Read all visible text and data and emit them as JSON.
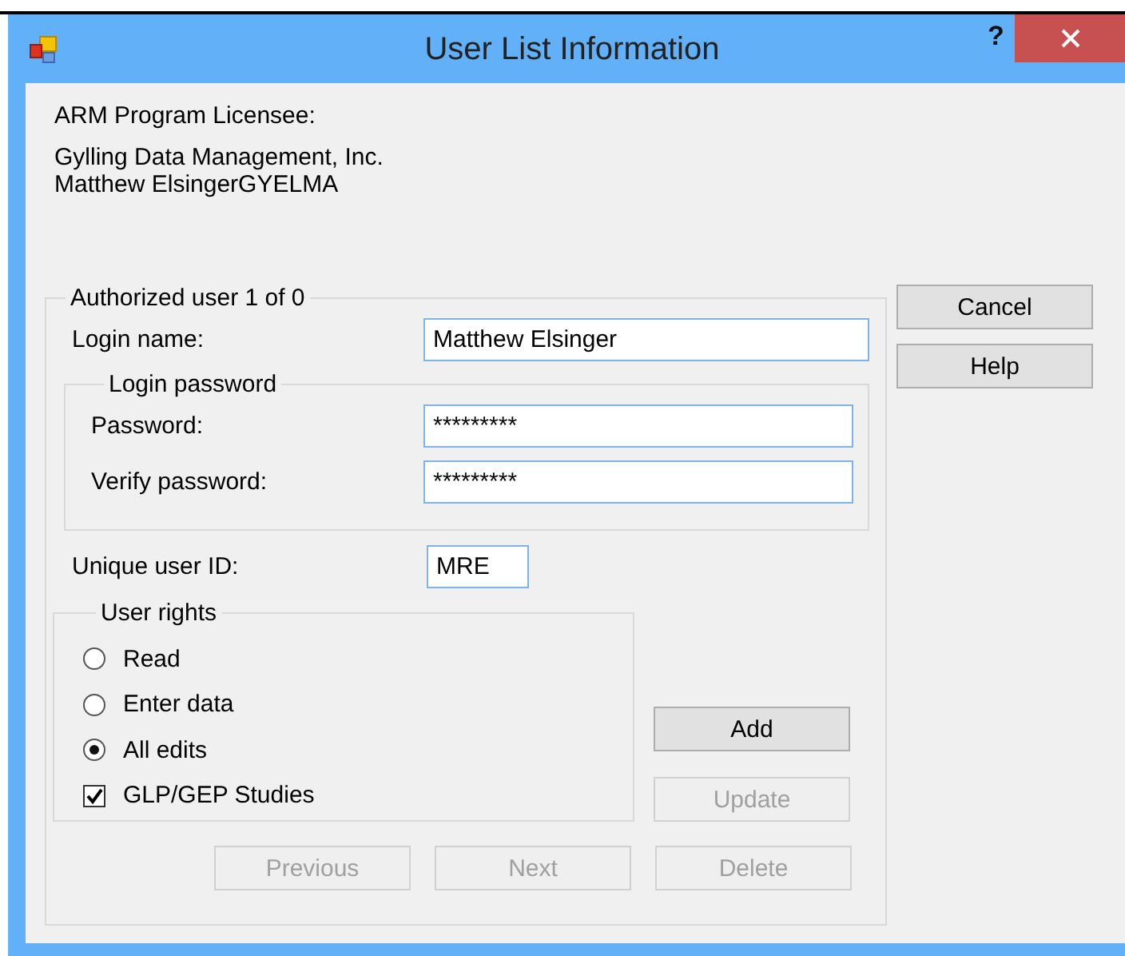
{
  "window": {
    "title": "User List Information",
    "help_glyph": "?"
  },
  "licensee": {
    "heading": "ARM Program Licensee:",
    "lines": [
      "Gylling Data Management, Inc.",
      "Matthew ElsingerGYELMA"
    ]
  },
  "user_group": {
    "title": "Authorized user 1 of 0",
    "login_name": {
      "label": "Login name:",
      "value": "Matthew Elsinger"
    },
    "password_group": {
      "title": "Login password",
      "fields": [
        {
          "label": "Password:",
          "value": "*********"
        },
        {
          "label": "Verify password:",
          "value": "*********"
        }
      ]
    },
    "unique_id": {
      "label": "Unique user ID:",
      "value": "MRE"
    },
    "rights": {
      "title": "User rights",
      "options": [
        {
          "kind": "radio",
          "label": "Read",
          "selected": false
        },
        {
          "kind": "radio",
          "label": "Enter data",
          "selected": false
        },
        {
          "kind": "radio",
          "label": "All edits",
          "selected": true
        },
        {
          "kind": "checkbox",
          "label": "GLP/GEP Studies",
          "checked": true
        }
      ]
    },
    "action_buttons": [
      {
        "label": "Add",
        "disabled": false
      },
      {
        "label": "Update",
        "disabled": true
      }
    ],
    "nav_buttons": [
      {
        "label": "Previous",
        "disabled": true
      },
      {
        "label": "Next",
        "disabled": true
      },
      {
        "label": "Delete",
        "disabled": true
      }
    ]
  },
  "side_buttons": [
    {
      "label": "Cancel",
      "disabled": false
    },
    {
      "label": "Help",
      "disabled": false
    }
  ]
}
